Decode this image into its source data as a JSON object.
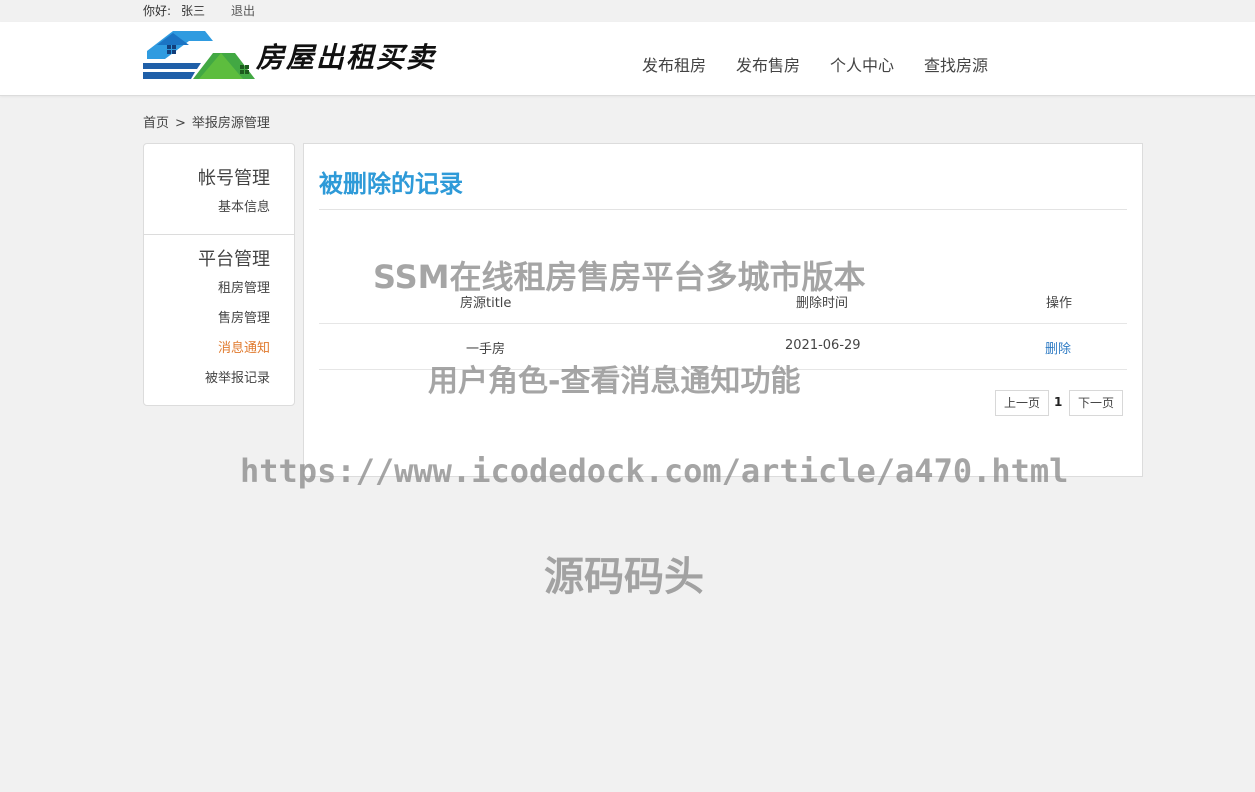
{
  "topbar": {
    "greeting": "你好:",
    "username": "张三",
    "logout": "退出"
  },
  "header": {
    "logo_text": "房屋出租买卖",
    "nav": [
      "发布租房",
      "发布售房",
      "个人中心",
      "查找房源"
    ]
  },
  "breadcrumb": {
    "home": "首页",
    "separator": ">",
    "current": "举报房源管理"
  },
  "sidebar": {
    "sections": [
      {
        "title": "帐号管理",
        "items": [
          "基本信息"
        ]
      },
      {
        "title": "平台管理",
        "items": [
          "租房管理",
          "售房管理",
          "消息通知",
          "被举报记录"
        ]
      }
    ],
    "active_item": "消息通知"
  },
  "main": {
    "title": "被删除的记录",
    "columns": [
      "房源title",
      "删除时间",
      "操作"
    ],
    "rows": [
      {
        "title": "一手房",
        "deleted_at": "2021-06-29",
        "action": "删除"
      }
    ]
  },
  "pager": {
    "prev": "上一页",
    "current": "1",
    "next": "下一页"
  },
  "watermarks": [
    "SSM在线租房售房平台多城市版本",
    "用户角色-查看消息通知功能",
    "https://www.icodedock.com/article/a470.html",
    "源码码头"
  ],
  "colors": {
    "accent": "#2e9ad8",
    "active_menu": "#e07a2e",
    "link": "#2e7bc4",
    "background": "#f1f1f1"
  }
}
